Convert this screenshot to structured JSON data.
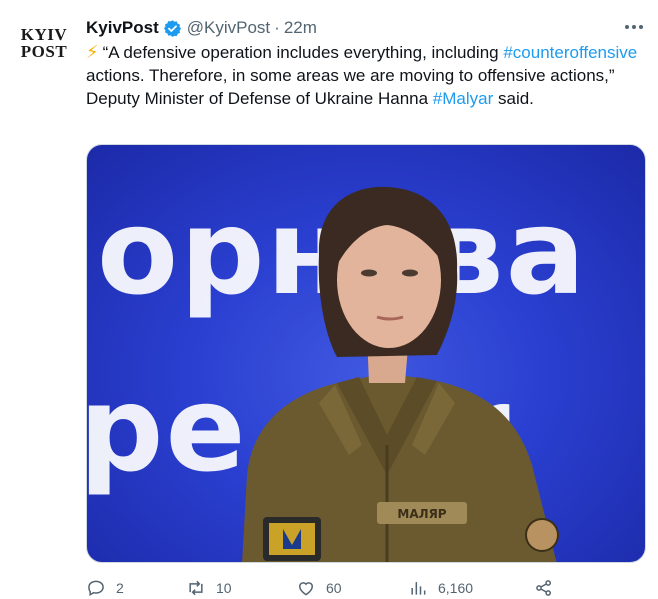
{
  "account": {
    "logo_line1": "KYIV",
    "logo_line2": "POST",
    "display_name": "KyivPost",
    "handle": "@KyivPost",
    "separator": "·",
    "time": "22m"
  },
  "tweet": {
    "emoji": "⚡",
    "text_part1": "“A defensive operation includes everything, including ",
    "hashtag1": "#counteroffensive",
    "text_part2": " actions. Therefore, in some areas we are moving to offensive actions,” Deputy Minister of Defense of Ukraine Hanna ",
    "hashtag2": "#Malyar",
    "text_part3": " said."
  },
  "media": {
    "background_text_line1": "орнува",
    "background_text_line2": "pe    ver",
    "name_patch": "МАЛЯР"
  },
  "actions": {
    "replies": "2",
    "retweets": "10",
    "likes": "60",
    "views": "6,160"
  },
  "colors": {
    "link": "#1d9bf0",
    "verified": "#1d9bf0",
    "muted": "#536471",
    "media_blue": "#2a3fd0"
  },
  "icons": [
    "verified-badge-icon",
    "more-icon",
    "reply-icon",
    "retweet-icon",
    "like-icon",
    "views-icon",
    "share-icon",
    "lightning-icon"
  ]
}
